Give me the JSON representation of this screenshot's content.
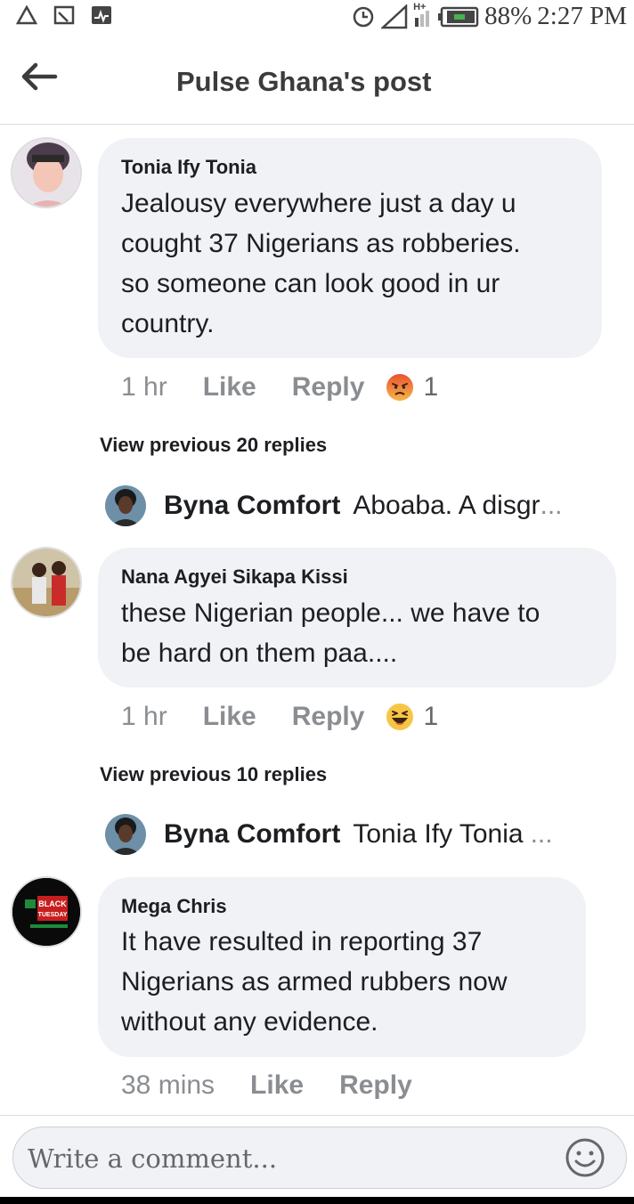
{
  "status_bar": {
    "battery": "88%",
    "time": "2:27 PM",
    "network": "H+"
  },
  "header": {
    "title": "Pulse Ghana's post"
  },
  "comments": [
    {
      "author": "Tonia Ify Tonia",
      "text_lines": [
        "Jealousy everywhere just a day u",
        "cought 37 Nigerians as robberies.",
        "so someone can look good in ur",
        "country."
      ],
      "time": "1 hr",
      "like": "Like",
      "reply": "Reply",
      "reaction": "angry",
      "reaction_count": "1",
      "view_previous": "View previous 20 replies",
      "latest_reply": {
        "author": "Byna Comfort",
        "text": "Aboaba. A disgr",
        "ellipsis": "..."
      }
    },
    {
      "author": "Nana Agyei Sikapa Kissi",
      "text_lines": [
        "these Nigerian people... we have to",
        "be hard on them paa...."
      ],
      "time": "1 hr",
      "like": "Like",
      "reply": "Reply",
      "reaction": "haha",
      "reaction_count": "1",
      "view_previous": "View previous 10 replies",
      "latest_reply": {
        "author": "Byna Comfort",
        "text": "Tonia Ify Tonia",
        "ellipsis": "..."
      }
    },
    {
      "author": "Mega Chris",
      "text_lines": [
        "It have resulted in reporting 37",
        "Nigerians as armed rubbers now",
        "without any evidence."
      ],
      "time": "38 mins",
      "like": "Like",
      "reply": "Reply",
      "avatar_text": [
        "BLACK",
        "TUESDAY"
      ]
    }
  ],
  "composer": {
    "placeholder": "Write a comment..."
  },
  "colors": {
    "bubble": "#f0f2f5",
    "meta": "#8a8d91",
    "angry": "#f26b36",
    "haha": "#f7c544"
  }
}
